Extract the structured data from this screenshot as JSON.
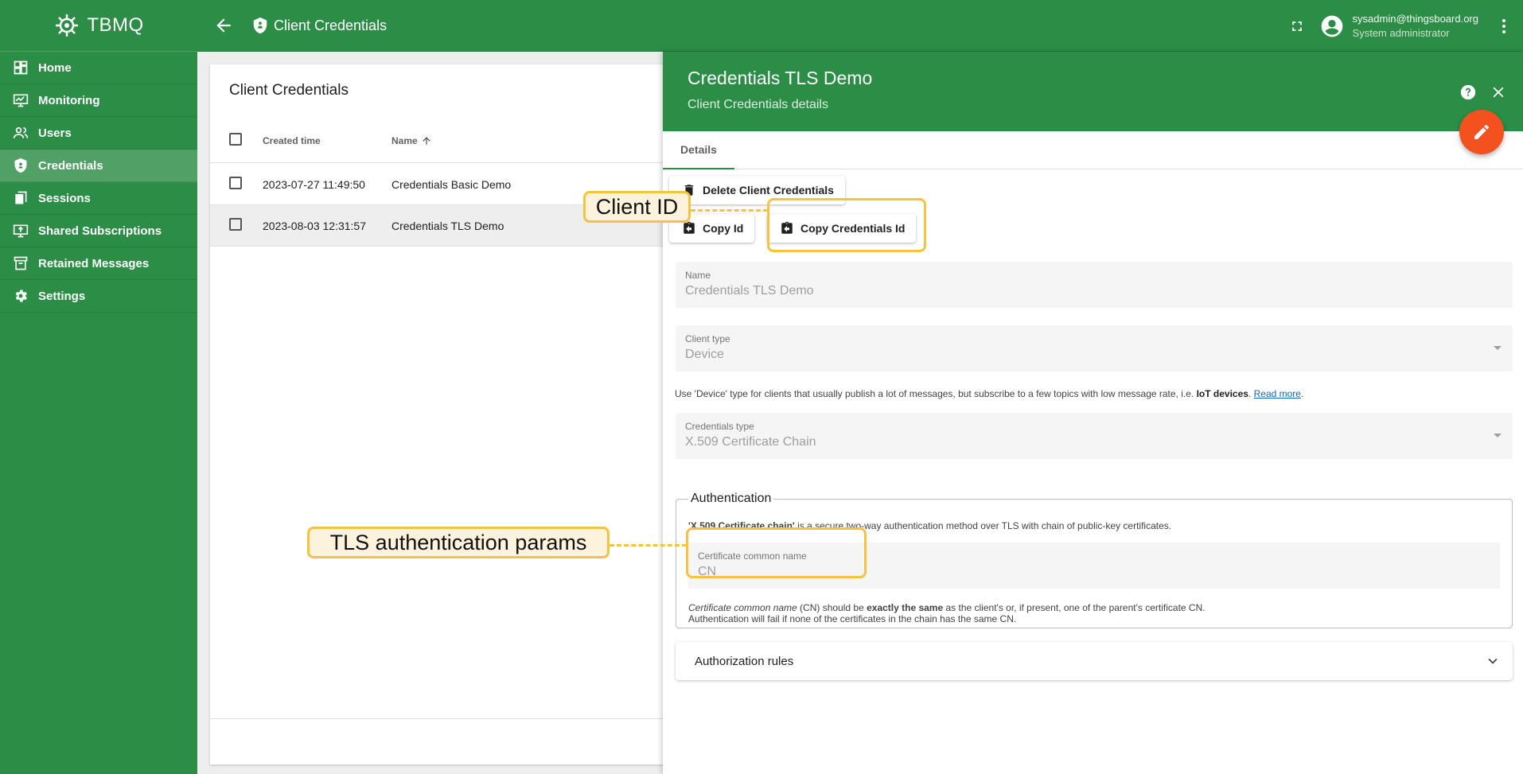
{
  "app": {
    "name": "TBMQ"
  },
  "sidebar": {
    "items": [
      {
        "label": "Home",
        "icon": "dashboard-icon"
      },
      {
        "label": "Monitoring",
        "icon": "monitor-icon"
      },
      {
        "label": "Users",
        "icon": "users-icon"
      },
      {
        "label": "Credentials",
        "icon": "shield-icon",
        "active": true
      },
      {
        "label": "Sessions",
        "icon": "sessions-icon"
      },
      {
        "label": "Shared Subscriptions",
        "icon": "subscriptions-icon"
      },
      {
        "label": "Retained Messages",
        "icon": "archive-icon"
      },
      {
        "label": "Settings",
        "icon": "gear-icon"
      }
    ]
  },
  "header": {
    "title": "Client Credentials",
    "user_email": "sysadmin@thingsboard.org",
    "user_role": "System administrator"
  },
  "table": {
    "title": "Client Credentials",
    "columns": {
      "created": "Created time",
      "name": "Name"
    },
    "rows": [
      {
        "created": "2023-07-27 11:49:50",
        "name": "Credentials Basic Demo"
      },
      {
        "created": "2023-08-03 12:31:57",
        "name": "Credentials TLS Demo"
      }
    ]
  },
  "details": {
    "title": "Credentials TLS Demo",
    "subtitle": "Client Credentials details",
    "tab": "Details",
    "delete_label": "Delete Client Credentials",
    "copy_id_label": "Copy Id",
    "copy_cred_label": "Copy Credentials Id",
    "name_label": "Name",
    "name_value": "Credentials TLS Demo",
    "client_type_label": "Client type",
    "client_type_value": "Device",
    "hint_pre": "Use 'Device' type for clients that usually publish a lot of messages, but subscribe to a few topics with low message rate, i.e. ",
    "hint_bold": "IoT devices",
    "hint_mid": ". ",
    "hint_link": "Read more",
    "hint_post": ".",
    "cred_type_label": "Credentials type",
    "cred_type_value": "X.509 Certificate Chain",
    "auth_legend": "Authentication",
    "auth_desc_bold": "'X.509 Certificate chain'",
    "auth_desc_rest": " is a secure two-way authentication method over TLS with chain of public-key certificates.",
    "cn_label": "Certificate common name",
    "cn_value": "CN",
    "note_italic": "Certificate common name",
    "note_a": " (CN) should be ",
    "note_bold": "exactly the same",
    "note_b": " as the client's or, if present, one of the parent's certificate CN.",
    "note_line2": "Authentication will fail if none of the certificates in the chain has the same CN.",
    "authz_label": "Authorization rules"
  },
  "annotations": {
    "client_id": "Client ID",
    "tls_params": "TLS authentication params"
  },
  "colors": {
    "primary": "#2b8d46",
    "accent": "#f4511e",
    "callout_border": "#f5c242",
    "callout_fill": "#fdf3dc"
  }
}
